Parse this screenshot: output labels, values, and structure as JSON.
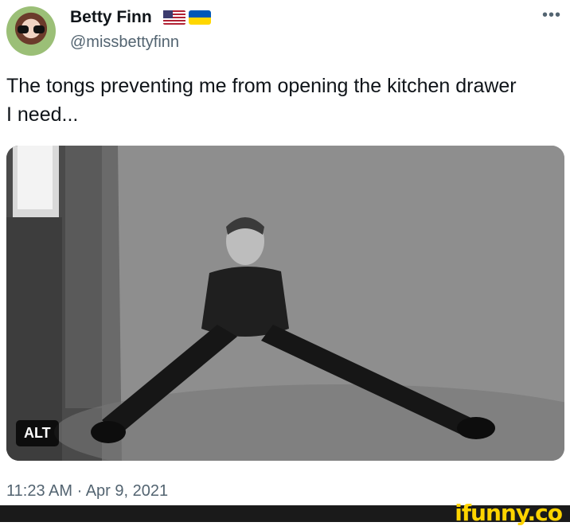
{
  "tweet": {
    "author_name": "Betty Finn",
    "handle": "@missbettyfinn",
    "text_line1": "The tongs preventing me from opening the kitchen drawer",
    "text_line2": "I need...",
    "timestamp": "11:23 AM · Apr 9, 2021",
    "alt_label": "ALT",
    "more_label": "•••",
    "flags": [
      "us-flag-icon",
      "ukraine-flag-icon"
    ]
  },
  "watermark": {
    "text": "ifunny.co"
  },
  "colors": {
    "text": "#0f1419",
    "secondary": "#536471",
    "watermark": "#ffd400"
  }
}
